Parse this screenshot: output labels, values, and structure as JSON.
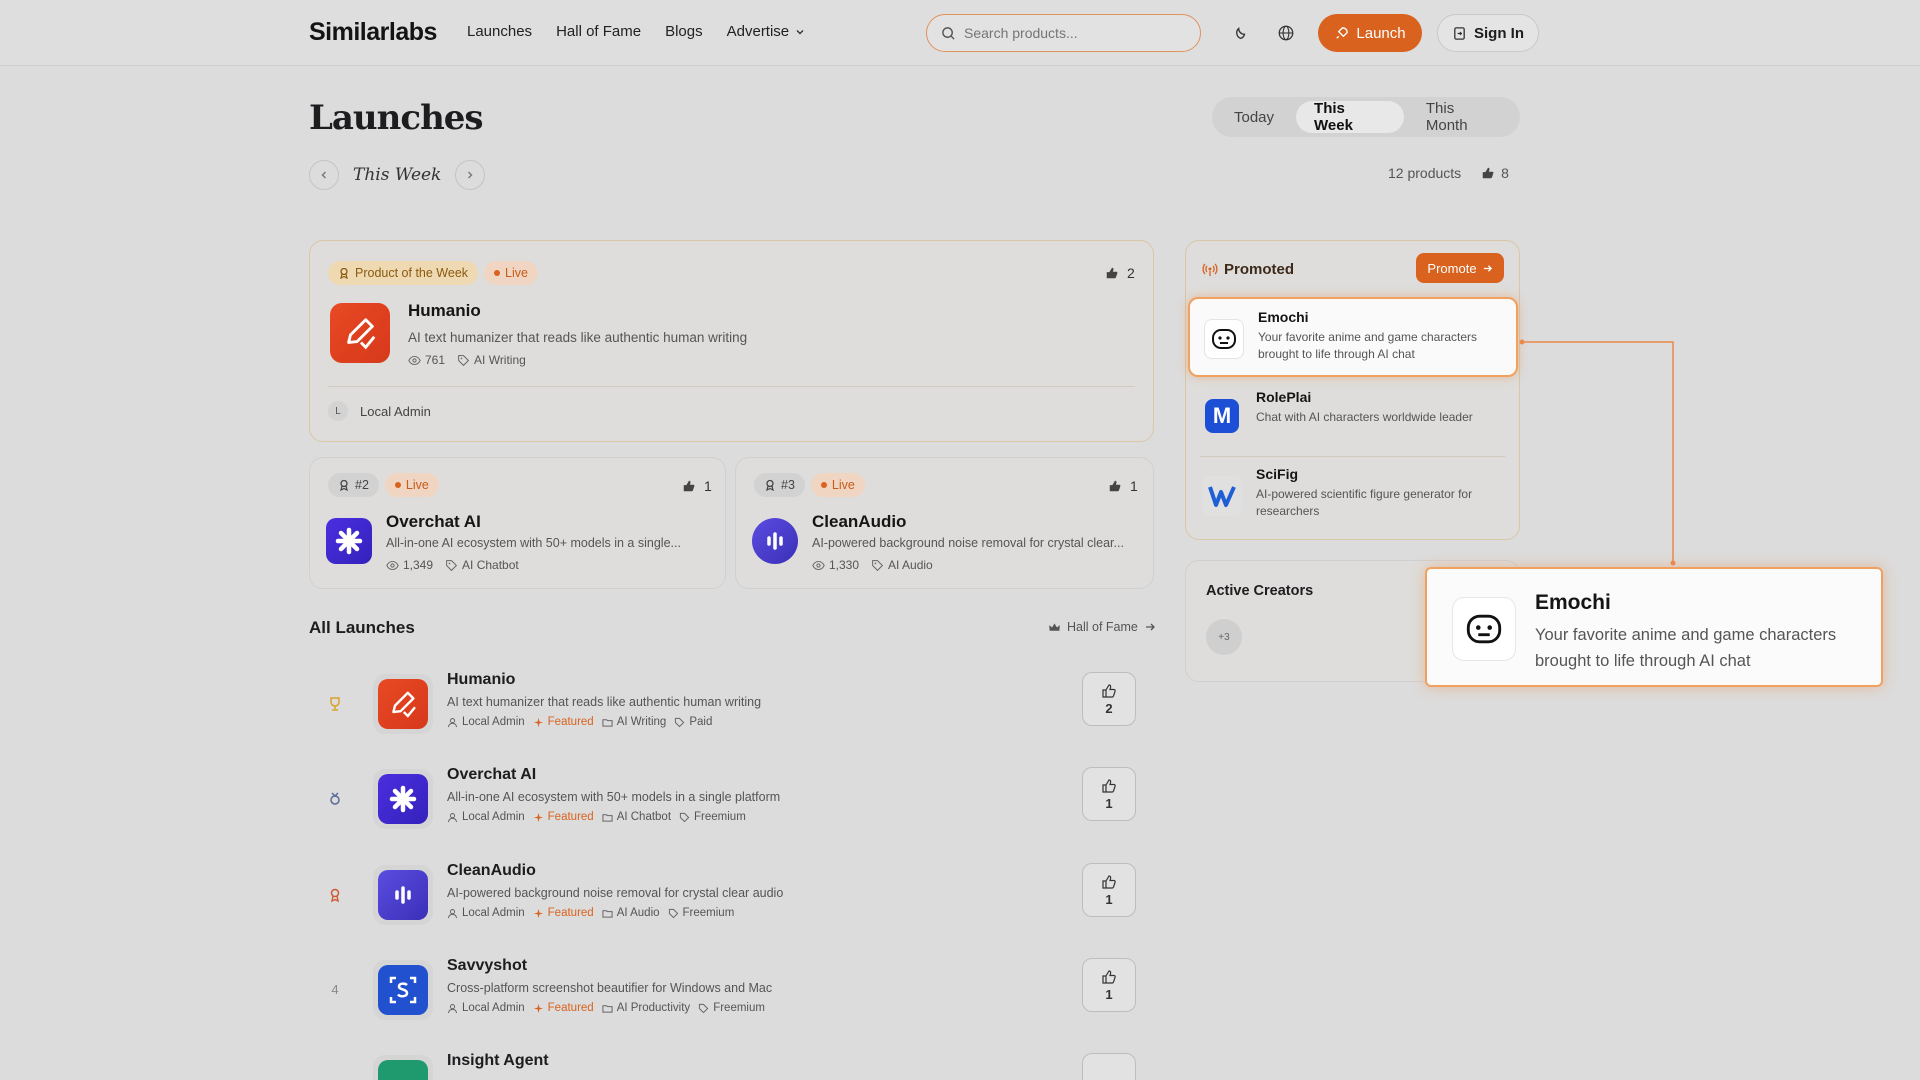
{
  "header": {
    "logo": "Similarlabs",
    "nav": [
      "Launches",
      "Hall of Fame",
      "Blogs",
      "Advertise"
    ],
    "search_placeholder": "Search products...",
    "launch_label": "Launch",
    "signin_label": "Sign In"
  },
  "page": {
    "title": "Launches",
    "periods": [
      "Today",
      "This Week",
      "This Month"
    ],
    "active_period": "This Week",
    "week_label": "This Week",
    "product_count": "12 products",
    "total_upvotes": "8"
  },
  "featured": {
    "badge": "Product of the Week",
    "live": "Live",
    "upvotes": "2",
    "name": "Humanio",
    "desc": "AI text humanizer that reads like authentic human writing",
    "views": "761",
    "category": "AI Writing",
    "author_initial": "L",
    "author": "Local Admin"
  },
  "runners": [
    {
      "rank": "#2",
      "live": "Live",
      "upvotes": "1",
      "name": "Overchat AI",
      "desc": "All-in-one AI ecosystem with 50+ models in a single...",
      "views": "1,349",
      "category": "AI Chatbot"
    },
    {
      "rank": "#3",
      "live": "Live",
      "upvotes": "1",
      "name": "CleanAudio",
      "desc": "AI-powered background noise removal for crystal clear...",
      "views": "1,330",
      "category": "AI Audio"
    }
  ],
  "all_launches": {
    "title": "All Launches",
    "hof_link": "Hall of Fame",
    "items": [
      {
        "rank": "",
        "name": "Humanio",
        "desc": "AI text humanizer that reads like authentic human writing",
        "author": "Local Admin",
        "featured": "Featured",
        "category": "AI Writing",
        "pricing": "Paid",
        "votes": "2"
      },
      {
        "rank": "",
        "name": "Overchat AI",
        "desc": "All-in-one AI ecosystem with 50+ models in a single platform",
        "author": "Local Admin",
        "featured": "Featured",
        "category": "AI Chatbot",
        "pricing": "Freemium",
        "votes": "1"
      },
      {
        "rank": "",
        "name": "CleanAudio",
        "desc": "AI-powered background noise removal for crystal clear audio",
        "author": "Local Admin",
        "featured": "Featured",
        "category": "AI Audio",
        "pricing": "Freemium",
        "votes": "1"
      },
      {
        "rank": "4",
        "name": "Savvyshot",
        "desc": "Cross-platform screenshot beautifier for Windows and Mac",
        "author": "Local Admin",
        "featured": "Featured",
        "category": "AI Productivity",
        "pricing": "Freemium",
        "votes": "1"
      },
      {
        "rank": "",
        "name": "Insight Agent",
        "desc": "",
        "author": "",
        "featured": "",
        "category": "",
        "pricing": "",
        "votes": ""
      }
    ]
  },
  "promoted": {
    "title": "Promoted",
    "button": "Promote",
    "items": [
      {
        "name": "Emochi",
        "desc": "Your favorite anime and game characters brought to life through AI chat"
      },
      {
        "name": "RolePlai",
        "desc": "Chat with AI characters worldwide leader"
      },
      {
        "name": "SciFig",
        "desc": "AI-powered scientific figure generator for researchers"
      }
    ]
  },
  "creators": {
    "title": "Active Creators",
    "more": "+3"
  },
  "tooltip": {
    "name": "Emochi",
    "desc": "Your favorite anime and game characters brought to life through AI chat"
  },
  "colors": {
    "accent": "#d9621f",
    "highlight": "#f0a160"
  }
}
